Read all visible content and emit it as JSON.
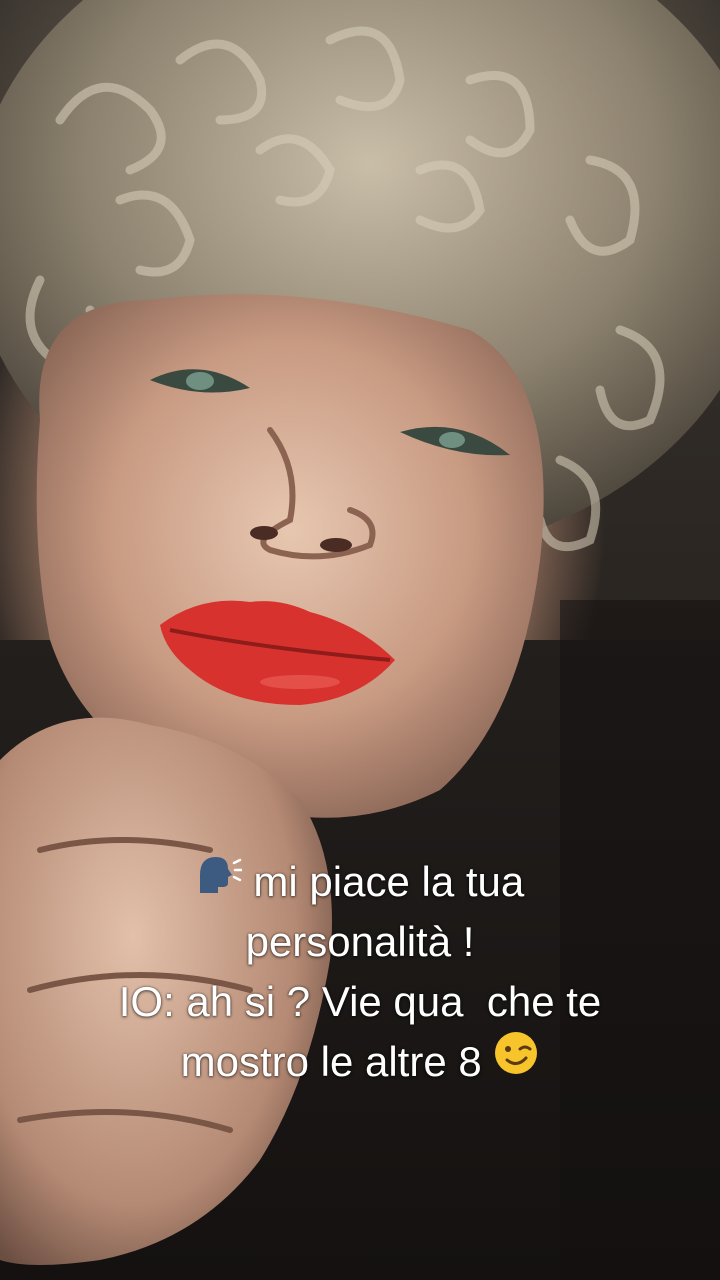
{
  "caption": {
    "line1": "mi piace la tua",
    "line2": "personalità !",
    "line3": "IO: ah si ? Vie qua  che te",
    "line4": "mostro le altre 8",
    "lead_icon": "speaking-head-icon",
    "trail_icon": "winking-face-icon"
  },
  "colors": {
    "text": "#ffffff",
    "lips": "#d8322e",
    "hair": "#a89c86",
    "background": "#1a1614"
  }
}
